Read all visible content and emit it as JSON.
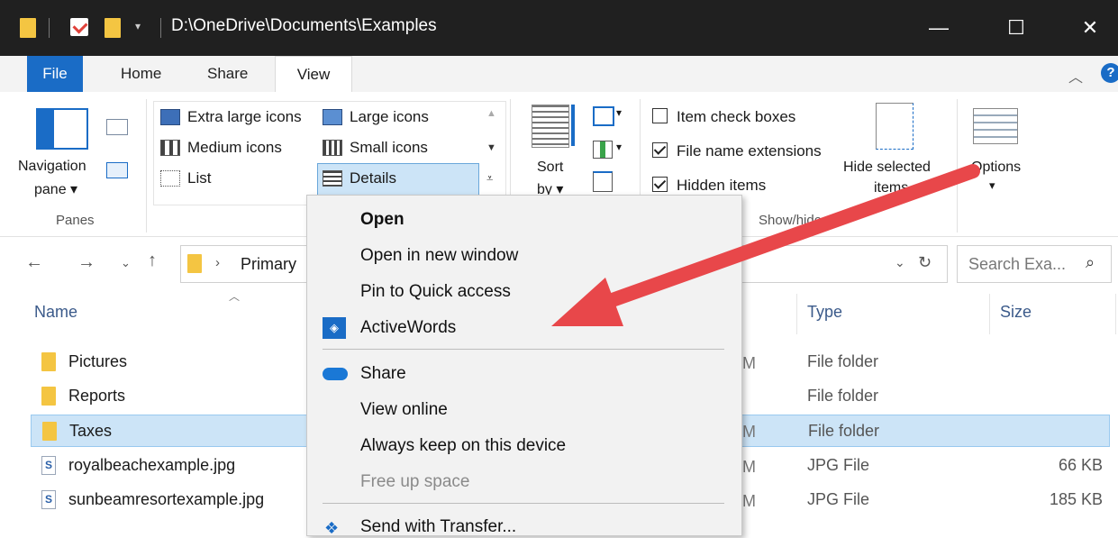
{
  "window": {
    "title": "D:\\OneDrive\\Documents\\Examples",
    "minimize": "—",
    "maximize": "☐",
    "close": "✕"
  },
  "ribbon": {
    "tabs": {
      "file": "File",
      "home": "Home",
      "share": "Share",
      "view": "View"
    },
    "panes": {
      "nav_line1": "Navigation",
      "nav_line2": "pane ▾",
      "group": "Panes"
    },
    "layout": {
      "extra_large": "Extra large icons",
      "large": "Large icons",
      "medium": "Medium icons",
      "small": "Small icons",
      "list": "List",
      "details": "Details"
    },
    "sort": {
      "line1": "Sort",
      "line2": "by ▾"
    },
    "show_hide": {
      "item_check_boxes": "Item check boxes",
      "file_name_extensions": "File name extensions",
      "hidden_items": "Hidden items",
      "hide_selected_line1": "Hide selected",
      "hide_selected_line2": "items",
      "group": "Show/hide"
    },
    "options": {
      "label": "Options",
      "caret": "▾"
    }
  },
  "address": {
    "crumb": "Primary",
    "search_placeholder": "Search Exa..."
  },
  "columns": {
    "name": "Name",
    "type": "Type",
    "size": "Size"
  },
  "files": [
    {
      "name": "Pictures",
      "type": "File folder",
      "size": "",
      "kind": "folder"
    },
    {
      "name": "Reports",
      "type": "File folder",
      "size": "",
      "kind": "folder"
    },
    {
      "name": "Taxes",
      "type": "File folder",
      "size": "",
      "kind": "folder",
      "selected": true
    },
    {
      "name": "royalbeachexample.jpg",
      "type": "JPG File",
      "size": "66 KB",
      "kind": "jpg"
    },
    {
      "name": "sunbeamresortexample.jpg",
      "type": "JPG File",
      "size": "185 KB",
      "kind": "jpg"
    }
  ],
  "context_menu": {
    "open": "Open",
    "open_new_window": "Open in new window",
    "pin_quick_access": "Pin to Quick access",
    "activewords": "ActiveWords",
    "share": "Share",
    "view_online": "View online",
    "always_keep": "Always keep on this device",
    "free_up_space": "Free up space",
    "send_with_transfer": "Send with Transfer..."
  },
  "colors": {
    "title_bar": "#202020",
    "file_tab": "#1a6cc6",
    "selection": "#cce4f7",
    "annotation_arrow": "#e8474a"
  }
}
